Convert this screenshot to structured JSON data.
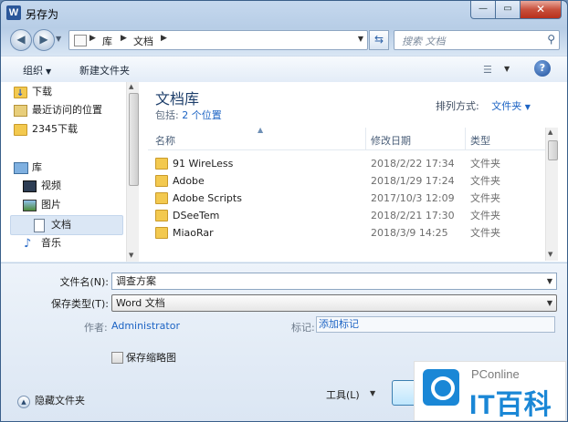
{
  "window": {
    "title": "另存为",
    "app_icon": "W"
  },
  "controls": {
    "minimize": "—",
    "maximize": "▭",
    "close": "✕"
  },
  "address": {
    "segments": [
      "库",
      "文档"
    ],
    "search_placeholder": "搜索 文档"
  },
  "toolbar": {
    "organize": "组织",
    "new_folder": "新建文件夹"
  },
  "nav": {
    "items": [
      {
        "label": "下载",
        "icon": "download-folder-icon"
      },
      {
        "label": "最近访问的位置",
        "icon": "recent-places-icon"
      },
      {
        "label": "2345下载",
        "icon": "folder-icon"
      },
      {
        "label": "库",
        "icon": "libraries-icon"
      },
      {
        "label": "视频",
        "icon": "videos-icon"
      },
      {
        "label": "图片",
        "icon": "pictures-icon"
      },
      {
        "label": "文档",
        "icon": "documents-icon",
        "selected": true
      },
      {
        "label": "音乐",
        "icon": "music-icon"
      }
    ]
  },
  "library": {
    "title": "文档库",
    "includes_prefix": "包括:",
    "includes_link": "2 个位置",
    "arrange_label": "排列方式:",
    "arrange_value": "文件夹"
  },
  "columns": {
    "name": "名称",
    "date": "修改日期",
    "type": "类型"
  },
  "files": [
    {
      "name": "91 WireLess",
      "date": "2018/2/22 17:34",
      "type": "文件夹"
    },
    {
      "name": "Adobe",
      "date": "2018/1/29 17:24",
      "type": "文件夹"
    },
    {
      "name": "Adobe Scripts",
      "date": "2017/10/3 12:09",
      "type": "文件夹"
    },
    {
      "name": "DSeeTem",
      "date": "2018/2/21 17:30",
      "type": "文件夹"
    },
    {
      "name": "MiaoRar",
      "date": "2018/3/9 14:25",
      "type": "文件夹"
    }
  ],
  "form": {
    "filename_label": "文件名(N):",
    "filename_value": "调查方案",
    "savetype_label": "保存类型(T):",
    "savetype_value": "Word 文档",
    "author_label": "作者:",
    "author_value": "Administrator",
    "tags_label": "标记:",
    "tags_value": "添加标记",
    "thumbnail_label": "保存缩略图",
    "hide_folders": "隐藏文件夹",
    "tools": "工具(L)"
  },
  "watermark": {
    "line1": "PConline",
    "line2": "IT百科"
  }
}
